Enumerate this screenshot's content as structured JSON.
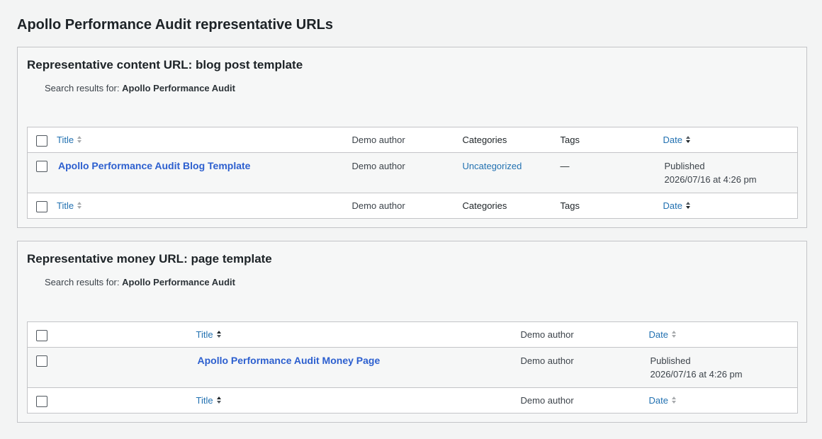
{
  "page_title": "Apollo Performance Audit representative URLs",
  "sections": [
    {
      "title": "Representative content URL: blog post template",
      "search_prefix": "Search results for:",
      "search_term": "Apollo Performance Audit",
      "columns": {
        "title": "Title",
        "author": "Demo author",
        "categories": "Categories",
        "tags": "Tags",
        "date": "Date"
      },
      "row": {
        "title": "Apollo Performance Audit Blog Template",
        "author": "Demo author",
        "category": "Uncategorized",
        "tags": "—",
        "status": "Published",
        "date": "2026/07/16 at 4:26 pm"
      }
    },
    {
      "title": "Representative money URL: page template",
      "search_prefix": "Search results for:",
      "search_term": "Apollo Performance Audit",
      "columns": {
        "title": "Title",
        "author": "Demo author",
        "date": "Date"
      },
      "row": {
        "title": "Apollo Performance Audit Money Page",
        "author": "Demo author",
        "status": "Published",
        "date": "2026/07/16 at 4:26 pm"
      }
    }
  ],
  "icons": {
    "sort": "sort-arrows-icon",
    "sort_desc": "sort-desc-icon"
  },
  "colors": {
    "link": "#2271b1",
    "title_link": "#2c5fcf",
    "border": "#c3c4c7",
    "background": "#f3f4f4"
  }
}
